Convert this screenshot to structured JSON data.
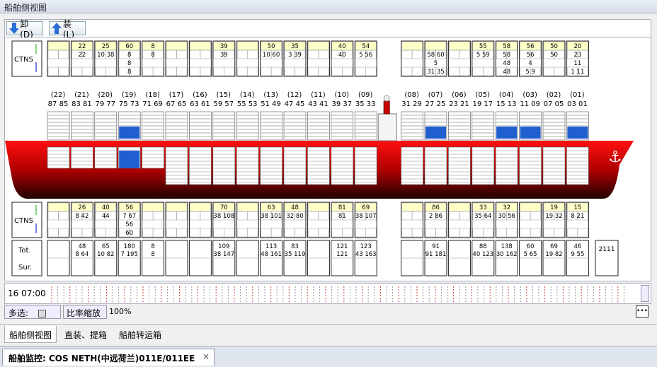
{
  "window": {
    "title": "船舶侧视图"
  },
  "toolbar": {
    "unload_label": "卸(D)",
    "load_label": "装(L)"
  },
  "ctns_label": "CTNS",
  "tot_label": "Tot.",
  "sur_label": "Sur.",
  "bays": [
    {
      "label": "(22)",
      "pair": "87 85"
    },
    {
      "label": "(21)",
      "pair": "83 81"
    },
    {
      "label": "(20)",
      "pair": "79 77"
    },
    {
      "label": "(19)",
      "pair": "75 73"
    },
    {
      "label": "(18)",
      "pair": "71 69"
    },
    {
      "label": "(17)",
      "pair": "67 65"
    },
    {
      "label": "(16)",
      "pair": "63 61"
    },
    {
      "label": "(15)",
      "pair": "59 57"
    },
    {
      "label": "(14)",
      "pair": "55 53"
    },
    {
      "label": "(13)",
      "pair": "51 49"
    },
    {
      "label": "(12)",
      "pair": "47 45"
    },
    {
      "label": "(11)",
      "pair": "43 41"
    },
    {
      "label": "(10)",
      "pair": "39 37"
    },
    {
      "label": "(09)",
      "pair": "35 33"
    },
    {
      "label": "(08)",
      "pair": "31 29"
    },
    {
      "label": "(07)",
      "pair": "27 25"
    },
    {
      "label": "(06)",
      "pair": "23 21"
    },
    {
      "label": "(05)",
      "pair": "19 17"
    },
    {
      "label": "(04)",
      "pair": "15 13"
    },
    {
      "label": "(03)",
      "pair": "11 09"
    },
    {
      "label": "(02)",
      "pair": "07 05"
    },
    {
      "label": "(01)",
      "pair": "03 01"
    }
  ],
  "deck_top": [
    {
      "a": "",
      "b": "",
      "c": "",
      "d": ""
    },
    {
      "a": "22",
      "b": "22",
      "c": "",
      "d": ""
    },
    {
      "a": "25",
      "b": "10 38",
      "c": "",
      "d": ""
    },
    {
      "a": "60",
      "b": "8",
      "c": "8",
      "d": "8"
    },
    {
      "a": "8",
      "b": "8",
      "c": "",
      "d": ""
    },
    {
      "a": "",
      "b": "",
      "c": "",
      "d": ""
    },
    {
      "a": "",
      "b": "",
      "c": "",
      "d": ""
    },
    {
      "a": "39",
      "b": "39",
      "c": "",
      "d": ""
    },
    {
      "a": "",
      "b": "",
      "c": "",
      "d": ""
    },
    {
      "a": "50",
      "b": "10 60",
      "c": "",
      "d": ""
    },
    {
      "a": "35",
      "b": "3 39",
      "c": "",
      "d": ""
    },
    {
      "a": "",
      "b": "",
      "c": "",
      "d": ""
    },
    {
      "a": "40",
      "b": "40",
      "c": "",
      "d": ""
    },
    {
      "a": "54",
      "b": "5 56",
      "c": "",
      "d": ""
    },
    {
      "a": "",
      "b": "",
      "c": "",
      "d": ""
    },
    {
      "a": "",
      "b": "58 60",
      "c": "5",
      "d": "31 35"
    },
    {
      "a": "",
      "b": "",
      "c": "",
      "d": ""
    },
    {
      "a": "55",
      "b": "5 59",
      "c": "",
      "d": ""
    },
    {
      "a": "58",
      "b": "58",
      "c": "48",
      "d": "48"
    },
    {
      "a": "56",
      "b": "56",
      "c": "4",
      "d": "5 9"
    },
    {
      "a": "50",
      "b": "50",
      "c": "",
      "d": ""
    },
    {
      "a": "20",
      "b": "23",
      "c": "11",
      "d": "1 11"
    }
  ],
  "deck_bottom": [
    {
      "a": "",
      "b": "",
      "c": "",
      "d": ""
    },
    {
      "a": "26",
      "b": "8 42",
      "c": "",
      "d": ""
    },
    {
      "a": "40",
      "b": "44",
      "c": "",
      "d": ""
    },
    {
      "a": "56",
      "b": "7 67",
      "c": "56",
      "d": "60"
    },
    {
      "a": "",
      "b": "",
      "c": "",
      "d": ""
    },
    {
      "a": "",
      "b": "",
      "c": "",
      "d": ""
    },
    {
      "a": "",
      "b": "",
      "c": "",
      "d": ""
    },
    {
      "a": "70",
      "b": "38 108",
      "c": "",
      "d": ""
    },
    {
      "a": "",
      "b": "",
      "c": "",
      "d": ""
    },
    {
      "a": "63",
      "b": "38 101",
      "c": "",
      "d": ""
    },
    {
      "a": "48",
      "b": "32 80",
      "c": "",
      "d": ""
    },
    {
      "a": "",
      "b": "",
      "c": "",
      "d": ""
    },
    {
      "a": "81",
      "b": "81",
      "c": "",
      "d": ""
    },
    {
      "a": "69",
      "b": "38 107",
      "c": "",
      "d": ""
    },
    {
      "a": "",
      "b": "",
      "c": "",
      "d": ""
    },
    {
      "a": "86",
      "b": "2 86",
      "c": "",
      "d": ""
    },
    {
      "a": "",
      "b": "",
      "c": "",
      "d": ""
    },
    {
      "a": "33",
      "b": "35 64",
      "c": "",
      "d": ""
    },
    {
      "a": "32",
      "b": "30 56",
      "c": "",
      "d": ""
    },
    {
      "a": "",
      "b": "",
      "c": "",
      "d": ""
    },
    {
      "a": "19",
      "b": "19 32",
      "c": "",
      "d": ""
    },
    {
      "a": "15",
      "b": "8 21",
      "c": "",
      "d": ""
    }
  ],
  "totals": [
    {
      "a": "",
      "b": ""
    },
    {
      "a": "48",
      "b": "8 64"
    },
    {
      "a": "65",
      "b": "10 82"
    },
    {
      "a": "180",
      "b": "7 195"
    },
    {
      "a": "8",
      "b": "8"
    },
    {
      "a": "",
      "b": ""
    },
    {
      "a": "",
      "b": ""
    },
    {
      "a": "109",
      "b": "38 147"
    },
    {
      "a": "",
      "b": ""
    },
    {
      "a": "113",
      "b": "48 161"
    },
    {
      "a": "83",
      "b": "35 119"
    },
    {
      "a": "",
      "b": ""
    },
    {
      "a": "121",
      "b": "121"
    },
    {
      "a": "123",
      "b": "43 163"
    },
    {
      "a": "",
      "b": ""
    },
    {
      "a": "91",
      "b": "91 181"
    },
    {
      "a": "",
      "b": ""
    },
    {
      "a": "88",
      "b": "40 123"
    },
    {
      "a": "138",
      "b": "30 162"
    },
    {
      "a": "60",
      "b": "5 65"
    },
    {
      "a": "69",
      "b": "19 82"
    },
    {
      "a": "46",
      "b": "9 55"
    }
  ],
  "grand_total": "2111",
  "timeline": {
    "time": "16 07:00"
  },
  "bottom": {
    "multi_label": "多选:",
    "scale_button": "比率缩放",
    "scale_value": "100%"
  },
  "tabs": [
    {
      "label": "船舶侧视图"
    },
    {
      "label": "直装、提箱"
    },
    {
      "label": "船舶转运箱"
    }
  ],
  "doc_tab": {
    "title": "船舶监控: COS NETH(中远荷兰)011E/011EE",
    "close": "×"
  },
  "colors": {
    "hull_red": "#e00000",
    "blue_container": "#1f5fd0",
    "yellow_cell": "#ffffc8"
  }
}
